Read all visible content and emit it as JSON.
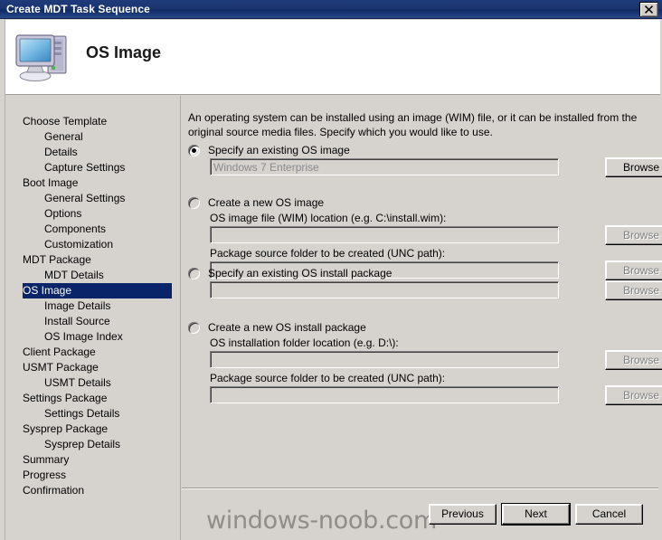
{
  "window": {
    "title": "Create MDT Task Sequence",
    "close_label": "×",
    "close_icon": "close-icon"
  },
  "header": {
    "title": "OS Image",
    "icon": "computer-icon"
  },
  "sidebar": {
    "items": [
      {
        "label": "Choose Template",
        "level": 0,
        "selected": false
      },
      {
        "label": "General",
        "level": 1,
        "selected": false
      },
      {
        "label": "Details",
        "level": 1,
        "selected": false
      },
      {
        "label": "Capture Settings",
        "level": 1,
        "selected": false
      },
      {
        "label": "Boot Image",
        "level": 0,
        "selected": false
      },
      {
        "label": "General Settings",
        "level": 1,
        "selected": false
      },
      {
        "label": "Options",
        "level": 1,
        "selected": false
      },
      {
        "label": "Components",
        "level": 1,
        "selected": false
      },
      {
        "label": "Customization",
        "level": 1,
        "selected": false
      },
      {
        "label": "MDT Package",
        "level": 0,
        "selected": false
      },
      {
        "label": "MDT Details",
        "level": 1,
        "selected": false
      },
      {
        "label": "OS Image",
        "level": 0,
        "selected": true
      },
      {
        "label": "Image Details",
        "level": 1,
        "selected": false
      },
      {
        "label": "Install Source",
        "level": 1,
        "selected": false
      },
      {
        "label": "OS Image Index",
        "level": 1,
        "selected": false
      },
      {
        "label": "Client Package",
        "level": 0,
        "selected": false
      },
      {
        "label": "USMT Package",
        "level": 0,
        "selected": false
      },
      {
        "label": "USMT Details",
        "level": 1,
        "selected": false
      },
      {
        "label": "Settings Package",
        "level": 0,
        "selected": false
      },
      {
        "label": "Settings Details",
        "level": 1,
        "selected": false
      },
      {
        "label": "Sysprep Package",
        "level": 0,
        "selected": false
      },
      {
        "label": "Sysprep Details",
        "level": 1,
        "selected": false
      },
      {
        "label": "Summary",
        "level": 0,
        "selected": false
      },
      {
        "label": "Progress",
        "level": 0,
        "selected": false
      },
      {
        "label": "Confirmation",
        "level": 0,
        "selected": false
      }
    ]
  },
  "main": {
    "intro": "An operating system can be installed using an image (WIM) file, or it can be installed from the original source media files.  Specify which you would like to use.",
    "browse_label": "Browse",
    "options": [
      {
        "id": "existing-os-image",
        "radio_label": "Specify an existing OS image",
        "checked": true,
        "fields": [
          {
            "label": "",
            "value": "Windows 7 Enterprise",
            "placeholder": "",
            "disabled": true,
            "browse_disabled": false,
            "indent": false
          }
        ]
      },
      {
        "id": "new-os-image",
        "radio_label": "Create a new OS image",
        "checked": false,
        "fields": [
          {
            "label": "OS image file (WIM) location (e.g. C:\\install.wim):",
            "value": "",
            "placeholder": "",
            "disabled": true,
            "browse_disabled": true,
            "indent": true
          },
          {
            "label": "Package source folder to be created (UNC path):",
            "value": "",
            "placeholder": "",
            "disabled": true,
            "browse_disabled": true,
            "indent": true
          }
        ]
      },
      {
        "id": "existing-os-install-package",
        "radio_label": "Specify an existing OS install package",
        "checked": false,
        "fields": [
          {
            "label": "",
            "value": "",
            "placeholder": "",
            "disabled": true,
            "browse_disabled": true,
            "indent": true
          }
        ]
      },
      {
        "id": "new-os-install-package",
        "radio_label": "Create a new OS install package",
        "checked": false,
        "fields": [
          {
            "label": "OS installation folder location (e.g. D:\\):",
            "value": "",
            "placeholder": "",
            "disabled": true,
            "browse_disabled": true,
            "indent": true
          },
          {
            "label": "Package source folder to be created (UNC path):",
            "value": "",
            "placeholder": "",
            "disabled": true,
            "browse_disabled": true,
            "indent": true
          }
        ]
      }
    ]
  },
  "footer": {
    "previous_label": "Previous",
    "next_label": "Next",
    "cancel_label": "Cancel"
  },
  "watermark": {
    "text": "windows-noob.com"
  },
  "colors": {
    "titlebar_start": "#1f3b7a",
    "titlebar_end": "#0e2a63",
    "dialog_face": "#d6d3ce",
    "selection": "#0a246a",
    "disabled_text": "#808080",
    "watermark": "#8f8d88"
  }
}
